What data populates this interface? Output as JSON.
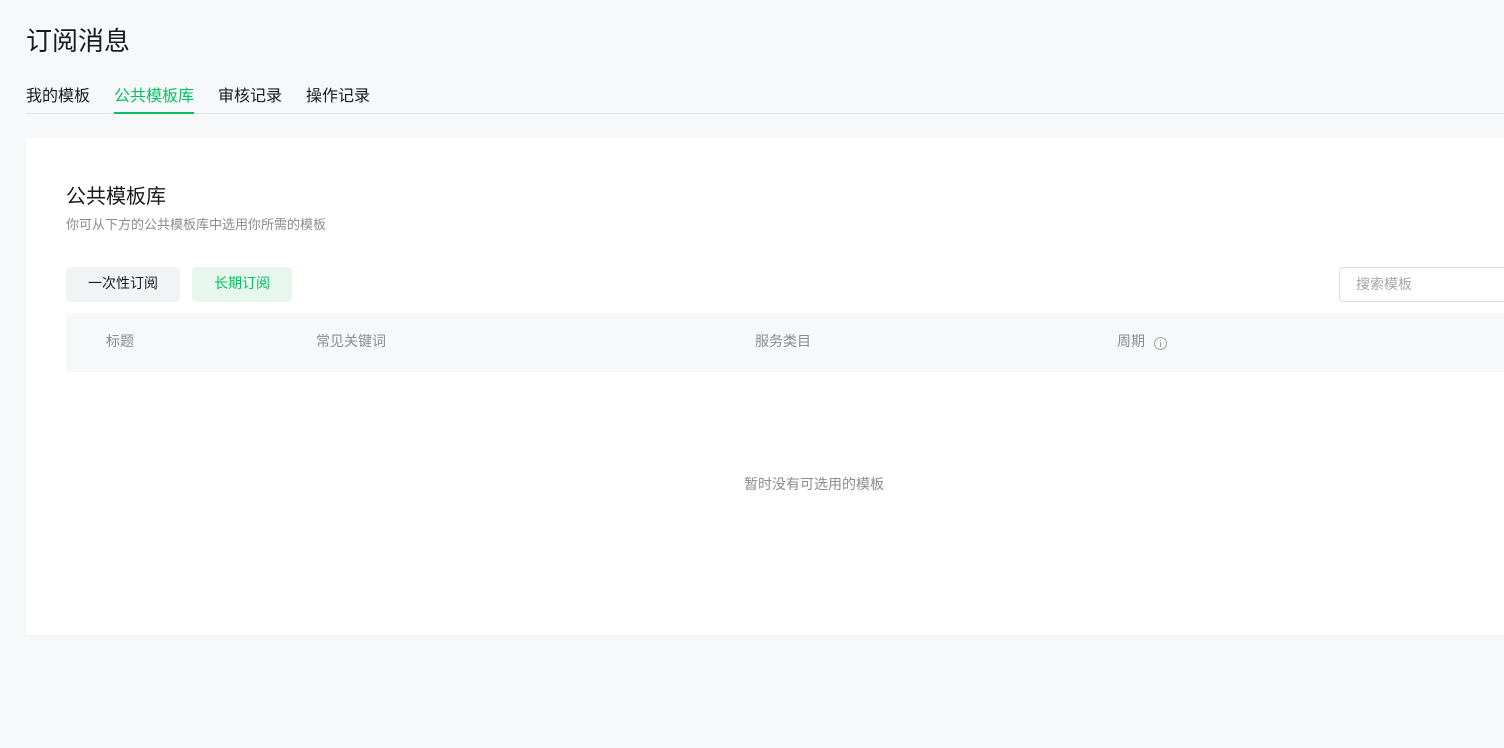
{
  "page": {
    "title": "订阅消息"
  },
  "tabs": [
    {
      "label": "我的模板",
      "active": false
    },
    {
      "label": "公共模板库",
      "active": true
    },
    {
      "label": "审核记录",
      "active": false
    },
    {
      "label": "操作记录",
      "active": false
    }
  ],
  "section": {
    "title": "公共模板库",
    "description": "你可从下方的公共模板库中选用你所需的模板"
  },
  "filters": {
    "one_time_label": "一次性订阅",
    "long_term_label": "长期订阅",
    "selected": "长期订阅"
  },
  "search": {
    "placeholder": "搜索模板",
    "value": ""
  },
  "table": {
    "columns": [
      "标题",
      "常见关键词",
      "服务类目",
      "周期"
    ],
    "rows": [],
    "empty_text": "暂时没有可选用的模板"
  },
  "colors": {
    "accent": "#07c160",
    "accent_bg": "#e8f7ee",
    "page_bg": "#f7f8fa"
  }
}
